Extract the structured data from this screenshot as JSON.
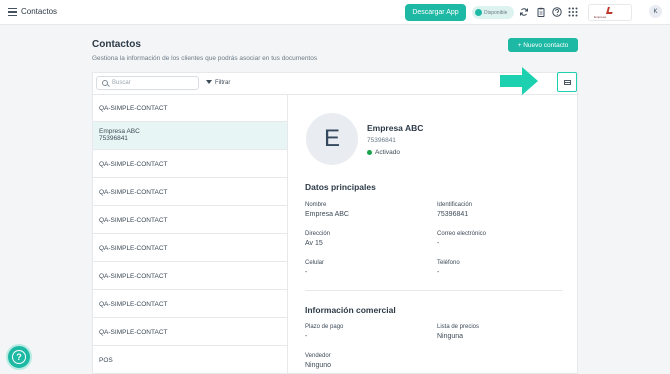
{
  "app": {
    "title": "Contactos"
  },
  "topbar": {
    "download_label": "Descargar App",
    "status_label": "Disponible",
    "company_logo_text": "Empresa",
    "avatar_initial": "K",
    "icons": [
      "sync-icon",
      "clipboard-icon",
      "help-icon",
      "apps-grid-icon"
    ]
  },
  "page": {
    "title": "Contactos",
    "subtitle": "Gestiona la información de los clientes que podrás asociar en tus documentos",
    "new_button": "+ Nuevo contacto"
  },
  "toolbar": {
    "search_placeholder": "Buscar",
    "filter_label": "Filtrar"
  },
  "contacts": [
    {
      "name": "QA-SIMPLE-CONTACT",
      "id": ""
    },
    {
      "name": "Empresa ABC",
      "id": "75396841"
    },
    {
      "name": "QA-SIMPLE-CONTACT",
      "id": ""
    },
    {
      "name": "QA-SIMPLE-CONTACT",
      "id": ""
    },
    {
      "name": "QA-SIMPLE-CONTACT",
      "id": ""
    },
    {
      "name": "QA-SIMPLE-CONTACT",
      "id": ""
    },
    {
      "name": "QA-SIMPLE-CONTACT",
      "id": ""
    },
    {
      "name": "QA-SIMPLE-CONTACT",
      "id": ""
    },
    {
      "name": "QA-SIMPLE-CONTACT",
      "id": ""
    },
    {
      "name": "POS",
      "id": ""
    }
  ],
  "detail": {
    "initial": "E",
    "name": "Empresa ABC",
    "id": "75396841",
    "status": "Activado",
    "main_section": "Datos principales",
    "commercial_section": "Información comercial",
    "fields": {
      "nombre_label": "Nombre",
      "nombre_value": "Empresa ABC",
      "identificacion_label": "Identificación",
      "identificacion_value": "75396841",
      "direccion_label": "Dirección",
      "direccion_value": "Av 15",
      "correo_label": "Correo electrónico",
      "correo_value": "-",
      "celular_label": "Celular",
      "celular_value": "-",
      "telefono_label": "Teléfono",
      "telefono_value": "-",
      "plazo_label": "Plazo de pago",
      "plazo_value": "-",
      "lista_label": "Lista de precios",
      "lista_value": "Ninguna",
      "vendedor_label": "Vendedor",
      "vendedor_value": "Ninguno"
    }
  },
  "colors": {
    "accent": "#1db9a4",
    "highlight": "#1dd1b0",
    "active_row": "#e7f6f4",
    "status_green": "#16a34a"
  }
}
